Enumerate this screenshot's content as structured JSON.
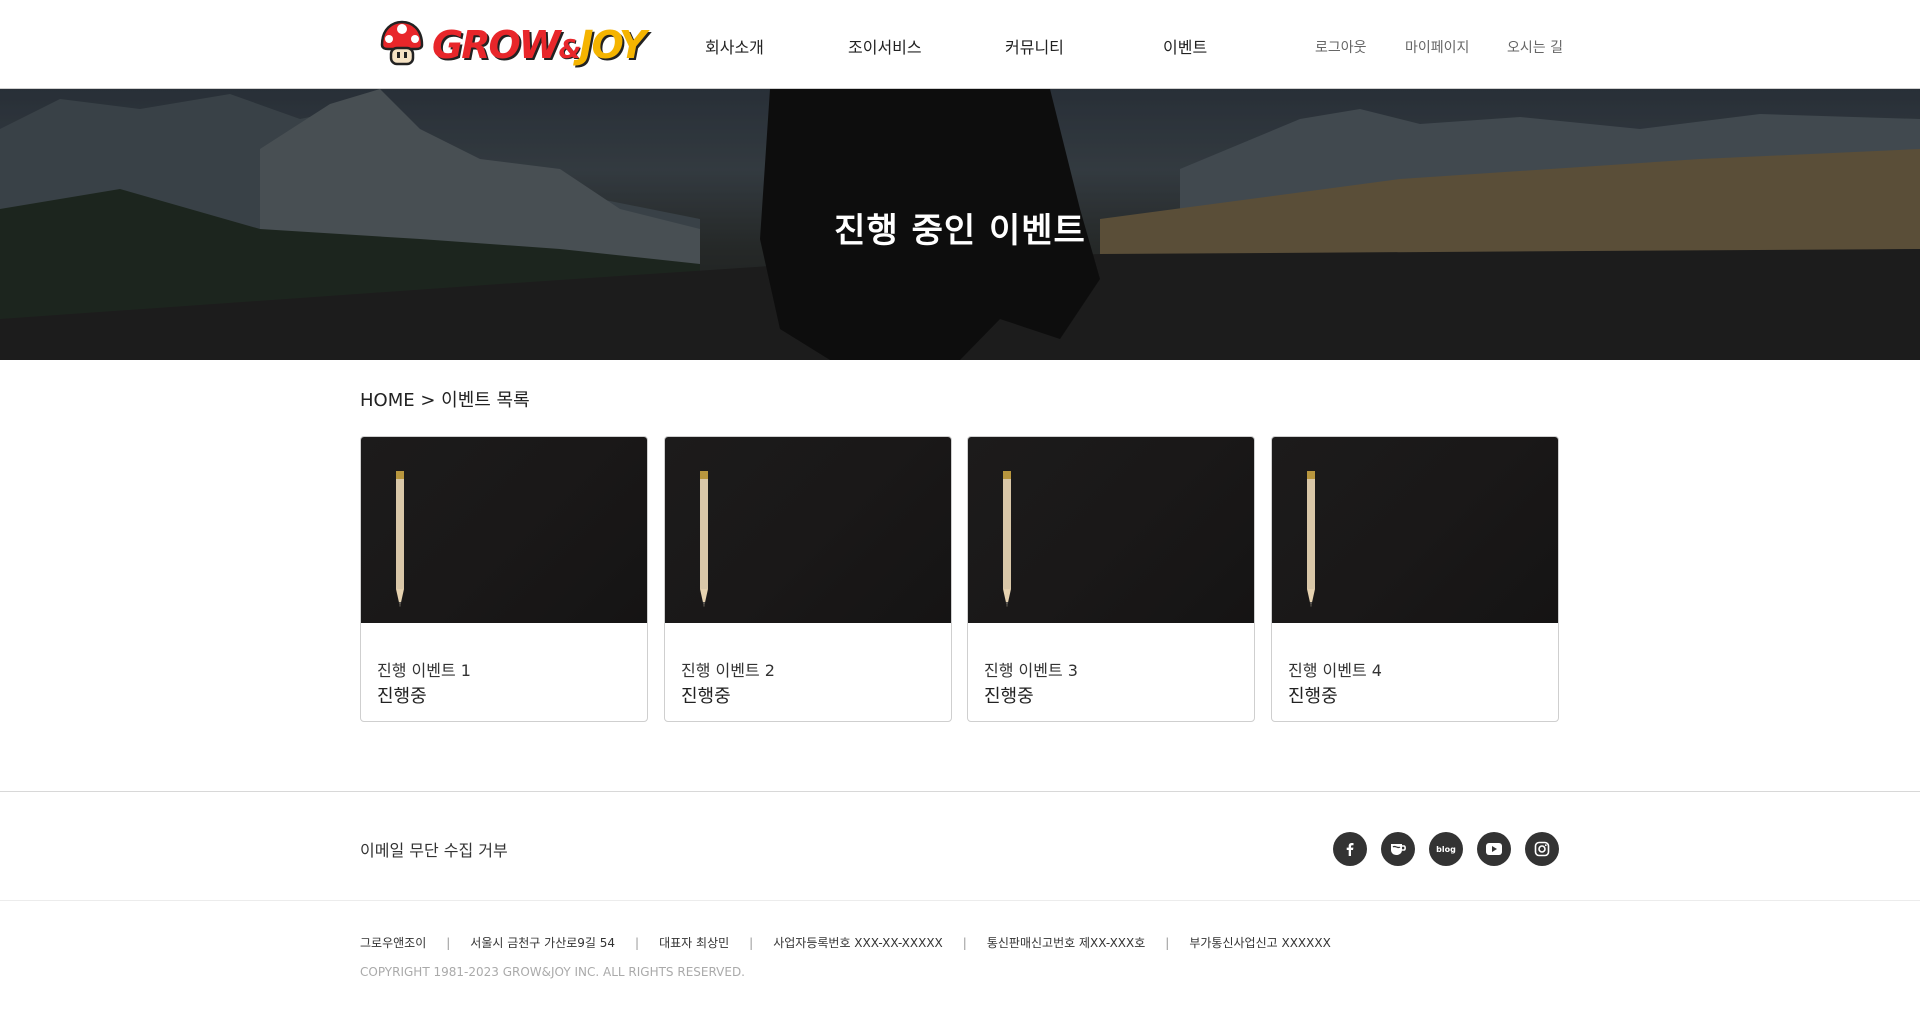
{
  "header": {
    "logo": {
      "grow": "GROW",
      "amp": "&",
      "joy": "JOY"
    },
    "nav": [
      "회사소개",
      "조이서비스",
      "커뮤니티",
      "이벤트"
    ],
    "util": [
      "로그아웃",
      "마이페이지",
      "오시는 길"
    ]
  },
  "banner": {
    "title": "진행 중인 이벤트"
  },
  "breadcrumb": "HOME > 이벤트 목록",
  "events": [
    {
      "title": "진행 이벤트 1",
      "status": "진행중"
    },
    {
      "title": "진행 이벤트 2",
      "status": "진행중"
    },
    {
      "title": "진행 이벤트 3",
      "status": "진행중"
    },
    {
      "title": "진행 이벤트 4",
      "status": "진행중"
    }
  ],
  "footer": {
    "policy": "이메일 무단 수집 거부",
    "sns_icons": [
      "facebook-icon",
      "cafe-icon",
      "blog-icon",
      "youtube-icon",
      "instagram-icon"
    ],
    "sns_blog_label": "blog",
    "info": [
      "그로우앤조이",
      "서울시 금천구 가산로9길 54",
      "대표자 최상민",
      "사업자등록번호 XXX-XX-XXXXX",
      "통신판매신고번호 제XX-XXX호",
      "부가통신사업신고 XXXXXX"
    ],
    "separator": "|",
    "copyright": "COPYRIGHT 1981-2023 GROW&JOY INC. ALL RIGHTS RESERVED."
  },
  "colors": {
    "brand_red": "#e8262a",
    "brand_yellow": "#f5b400",
    "sns_bg": "#333333"
  }
}
